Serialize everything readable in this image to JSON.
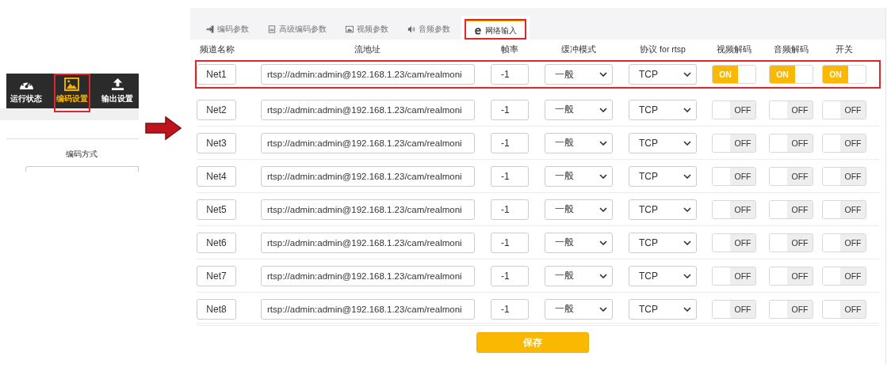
{
  "nav": [
    {
      "label": "运行状态",
      "selected": false
    },
    {
      "label": "编码设置",
      "selected": true
    },
    {
      "label": "输出设置",
      "selected": false
    }
  ],
  "left_field_label": "编码方式",
  "tabs": [
    {
      "label": "编码参数",
      "selected": false
    },
    {
      "label": "高级编码参数",
      "selected": false
    },
    {
      "label": "视频参数",
      "selected": false
    },
    {
      "label": "音频参数",
      "selected": false
    },
    {
      "label": "网络输入",
      "selected": true
    }
  ],
  "columns": [
    "频道名称",
    "流地址",
    "帧率",
    "缓冲模式",
    "协议 for rtsp",
    "视频解码",
    "音频解码",
    "开关"
  ],
  "rows": [
    {
      "name": "Net1",
      "url": "rtsp://admin:admin@192.168.1.23/cam/realmoni",
      "fps": "-1",
      "buffer": "一般",
      "protocol": "TCP",
      "toggles": [
        {
          "label": "ON",
          "on": true
        },
        {
          "label": "ON",
          "on": true
        },
        {
          "label": "ON",
          "on": true
        }
      ],
      "highlighted": true
    },
    {
      "name": "Net2",
      "url": "rtsp://admin:admin@192.168.1.23/cam/realmoni",
      "fps": "-1",
      "buffer": "一般",
      "protocol": "TCP",
      "toggles": [
        {
          "label": "OFF",
          "on": false
        },
        {
          "label": "OFF",
          "on": false
        },
        {
          "label": "OFF",
          "on": false
        }
      ],
      "highlighted": false
    },
    {
      "name": "Net3",
      "url": "rtsp://admin:admin@192.168.1.23/cam/realmoni",
      "fps": "-1",
      "buffer": "一般",
      "protocol": "TCP",
      "toggles": [
        {
          "label": "OFF",
          "on": false
        },
        {
          "label": "OFF",
          "on": false
        },
        {
          "label": "OFF",
          "on": false
        }
      ],
      "highlighted": false
    },
    {
      "name": "Net4",
      "url": "rtsp://admin:admin@192.168.1.23/cam/realmoni",
      "fps": "-1",
      "buffer": "一般",
      "protocol": "TCP",
      "toggles": [
        {
          "label": "OFF",
          "on": false
        },
        {
          "label": "OFF",
          "on": false
        },
        {
          "label": "OFF",
          "on": false
        }
      ],
      "highlighted": false
    },
    {
      "name": "Net5",
      "url": "rtsp://admin:admin@192.168.1.23/cam/realmoni",
      "fps": "-1",
      "buffer": "一般",
      "protocol": "TCP",
      "toggles": [
        {
          "label": "OFF",
          "on": false
        },
        {
          "label": "OFF",
          "on": false
        },
        {
          "label": "OFF",
          "on": false
        }
      ],
      "highlighted": false
    },
    {
      "name": "Net6",
      "url": "rtsp://admin:admin@192.168.1.23/cam/realmoni",
      "fps": "-1",
      "buffer": "一般",
      "protocol": "TCP",
      "toggles": [
        {
          "label": "OFF",
          "on": false
        },
        {
          "label": "OFF",
          "on": false
        },
        {
          "label": "OFF",
          "on": false
        }
      ],
      "highlighted": false
    },
    {
      "name": "Net7",
      "url": "rtsp://admin:admin@192.168.1.23/cam/realmoni",
      "fps": "-1",
      "buffer": "一般",
      "protocol": "TCP",
      "toggles": [
        {
          "label": "OFF",
          "on": false
        },
        {
          "label": "OFF",
          "on": false
        },
        {
          "label": "OFF",
          "on": false
        }
      ],
      "highlighted": false
    },
    {
      "name": "Net8",
      "url": "rtsp://admin:admin@192.168.1.23/cam/realmoni",
      "fps": "-1",
      "buffer": "一般",
      "protocol": "TCP",
      "toggles": [
        {
          "label": "OFF",
          "on": false
        },
        {
          "label": "OFF",
          "on": false
        },
        {
          "label": "OFF",
          "on": false
        }
      ],
      "highlighted": false
    }
  ],
  "save_button": "保存"
}
